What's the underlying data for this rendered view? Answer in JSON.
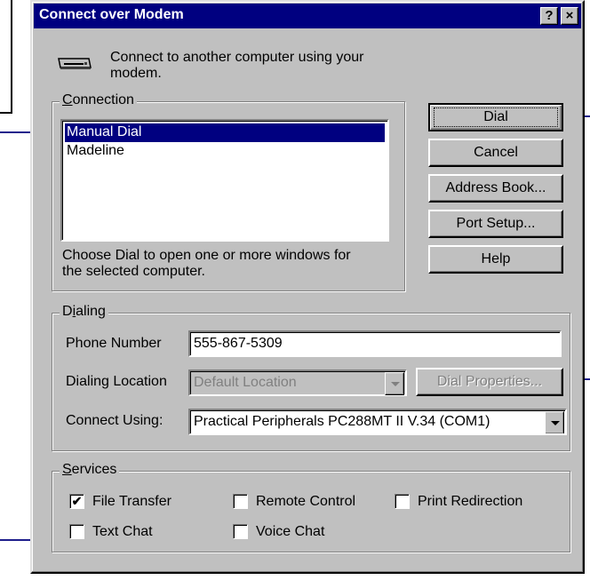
{
  "window": {
    "title": "Connect over Modem",
    "help_glyph": "?",
    "close_glyph": "×"
  },
  "intro": {
    "icon": "modem-icon",
    "text_line1": "Connect to another computer using your",
    "text_line2": "modem."
  },
  "connection": {
    "group_label": "Connection",
    "items": [
      {
        "label": "Manual Dial",
        "selected": true
      },
      {
        "label": "Madeline",
        "selected": false
      }
    ],
    "hint_line1": "Choose Dial to open one or more windows for",
    "hint_line2": "the selected computer."
  },
  "buttons": {
    "dial": "Dial",
    "cancel": "Cancel",
    "address_book": "Address Book...",
    "port_setup": "Port Setup...",
    "help": "Help"
  },
  "dialing": {
    "group_label": "Dialing",
    "phone_label": "Phone Number",
    "phone_value": "555-867-5309",
    "location_label": "Dialing Location",
    "location_value": "Default Location",
    "dial_properties": "Dial Properties...",
    "connect_using_label": "Connect Using:",
    "connect_using_value": "Practical Peripherals PC288MT II V.34 (COM1)"
  },
  "services": {
    "group_label": "Services",
    "options": {
      "file_transfer": {
        "label": "File Transfer",
        "checked": true
      },
      "remote_control": {
        "label": "Remote Control",
        "checked": false
      },
      "print_redirection": {
        "label": "Print Redirection",
        "checked": false
      },
      "text_chat": {
        "label": "Text Chat",
        "checked": false
      },
      "voice_chat": {
        "label": "Voice Chat",
        "checked": false
      }
    },
    "check_glyph": "✔"
  },
  "colors": {
    "title_bar": "#000080",
    "face": "#c0c0c0",
    "selection": "#000080",
    "callout_line": "#1e1e8c"
  }
}
